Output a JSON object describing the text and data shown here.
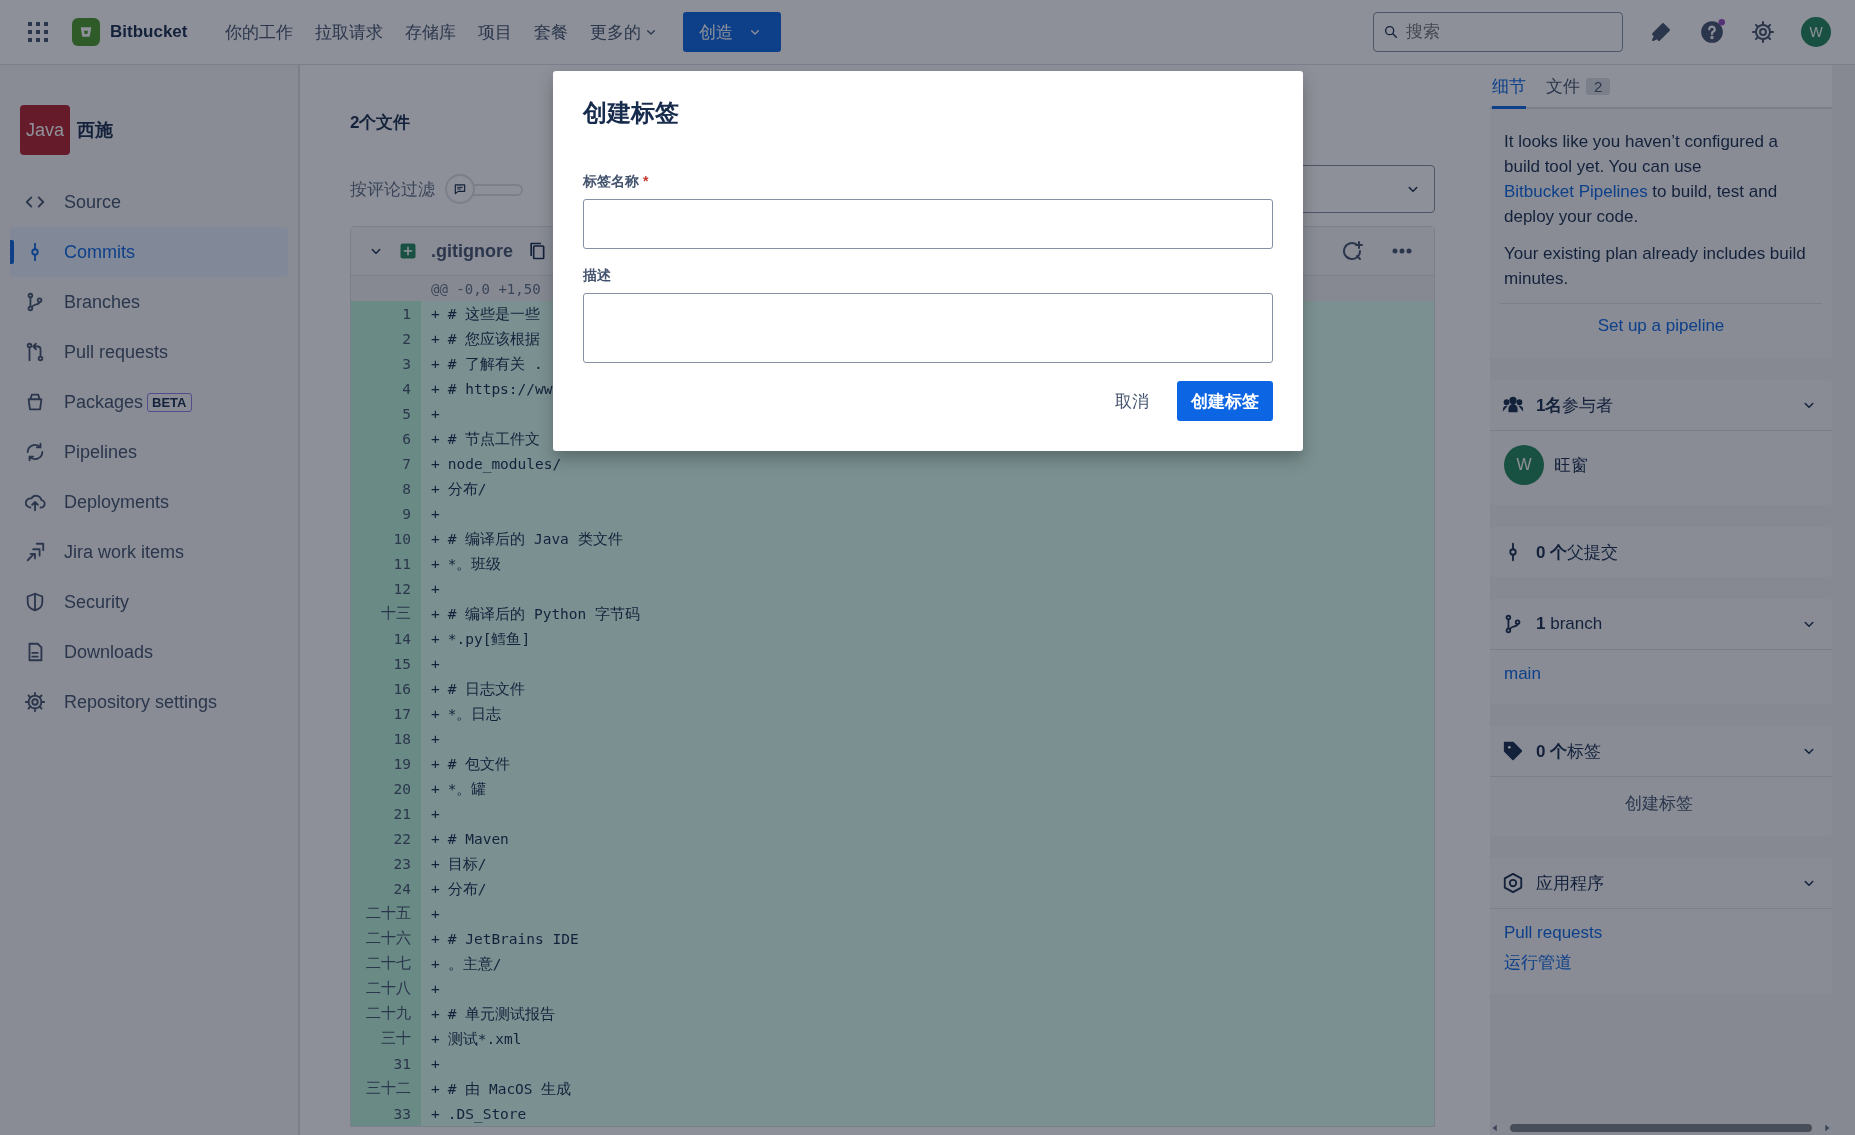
{
  "topbar": {
    "product": "Bitbucket",
    "nav": [
      {
        "label": "你的工作",
        "kind": "link"
      },
      {
        "label": "拉取请求",
        "kind": "link"
      },
      {
        "label": "存储库",
        "kind": "link"
      },
      {
        "label": "项目",
        "kind": "link"
      },
      {
        "label": "套餐",
        "kind": "link"
      },
      {
        "label": "更多的",
        "kind": "menu"
      }
    ],
    "create_button": "创造",
    "search": {
      "placeholder": "搜索"
    },
    "avatar": "W"
  },
  "repo": {
    "badge": "Java",
    "name": "西施"
  },
  "sidebar": {
    "items": [
      {
        "label": "Source",
        "kind": "source",
        "selected": false
      },
      {
        "label": "Commits",
        "kind": "commits",
        "selected": true
      },
      {
        "label": "Branches",
        "kind": "branches",
        "selected": false
      },
      {
        "label": "Pull requests",
        "kind": "pull_requests",
        "selected": false
      },
      {
        "label": "Packages",
        "kind": "packages",
        "selected": false,
        "badge": "BETA"
      },
      {
        "label": "Pipelines",
        "kind": "pipelines",
        "selected": false
      },
      {
        "label": "Deployments",
        "kind": "deployments",
        "selected": false
      },
      {
        "label": "Jira work items",
        "kind": "jira",
        "selected": false
      },
      {
        "label": "Security",
        "kind": "security",
        "selected": false
      },
      {
        "label": "Downloads",
        "kind": "downloads",
        "selected": false
      },
      {
        "label": "Repository settings",
        "kind": "settings",
        "selected": false
      }
    ]
  },
  "diff": {
    "title": "2个文件",
    "filter_label": "按评论过滤",
    "filter_toggle": {
      "on": false
    },
    "file": {
      "name": ".gitignore",
      "expanded": true
    },
    "hunk": "@@ -0,0 +1,50",
    "lines": [
      {
        "number": "1",
        "marker": "+",
        "code": "# 这些是一些"
      },
      {
        "number": "2",
        "marker": "+",
        "code": "# 您应该根据"
      },
      {
        "number": "3",
        "marker": "+",
        "code": "# 了解有关 ."
      },
      {
        "number": "4",
        "marker": "+",
        "code": "# https://ww"
      },
      {
        "number": "5",
        "marker": "+"
      },
      {
        "number": "6",
        "marker": "+",
        "code": "# 节点工件文"
      },
      {
        "number": "7",
        "marker": "+",
        "code": "node_modules/"
      },
      {
        "number": "8",
        "marker": "+",
        "code": "分布/"
      },
      {
        "number": "9",
        "marker": "+"
      },
      {
        "number": "10",
        "marker": "+",
        "code": "# 编译后的 Java 类文件"
      },
      {
        "number": "11",
        "marker": "+",
        "code": "*。班级"
      },
      {
        "number": "12",
        "marker": "+"
      },
      {
        "number": "十三",
        "marker": "+",
        "code": "# 编译后的 Python 字节码"
      },
      {
        "number": "14",
        "marker": "+",
        "code": "*.py[鳕鱼]"
      },
      {
        "number": "15",
        "marker": "+"
      },
      {
        "number": "16",
        "marker": "+",
        "code": "# 日志文件"
      },
      {
        "number": "17",
        "marker": "+",
        "code": "*。日志"
      },
      {
        "number": "18",
        "marker": "+"
      },
      {
        "number": "19",
        "marker": "+",
        "code": "# 包文件"
      },
      {
        "number": "20",
        "marker": "+",
        "code": "*。罐"
      },
      {
        "number": "21",
        "marker": "+"
      },
      {
        "number": "22",
        "marker": "+",
        "code": "# Maven"
      },
      {
        "number": "23",
        "marker": "+",
        "code": "目标/"
      },
      {
        "number": "24",
        "marker": "+",
        "code": "分布/"
      },
      {
        "number": "二十五",
        "marker": "+"
      },
      {
        "number": "二十六",
        "marker": "+",
        "code": "# JetBrains IDE"
      },
      {
        "number": "二十七",
        "marker": "+",
        "code": "。主意/"
      },
      {
        "number": "二十八",
        "marker": "+"
      },
      {
        "number": "二十九",
        "marker": "+",
        "code": "# 单元测试报告"
      },
      {
        "number": "三十",
        "marker": "+",
        "code": "测试*.xml"
      },
      {
        "number": "31",
        "marker": "+"
      },
      {
        "number": "三十二",
        "marker": "+",
        "code": "# 由 MacOS 生成"
      },
      {
        "number": "33",
        "marker": "+",
        "code": ".DS_Store"
      }
    ]
  },
  "modal": {
    "title": "创建标签",
    "fields": [
      {
        "label": "标签名称",
        "required_mark": "*",
        "kind": "input"
      },
      {
        "label": "描述",
        "kind": "textarea"
      }
    ],
    "buttons": [
      {
        "label": "取消",
        "kind": "subtle"
      },
      {
        "label": "创建标签",
        "kind": "primary"
      }
    ]
  },
  "right_panel": {
    "tabs": [
      {
        "label": "细节",
        "selected": true
      },
      {
        "label": "文件",
        "count": "2",
        "selected": false
      }
    ],
    "pipeline_card": {
      "before": "It looks like you haven’t configured a build tool yet. You can use ",
      "link": "Bitbucket Pipelines",
      "after": " to build, test and deploy your code.",
      "plan": "Your existing plan already includes build minutes.",
      "action": "Set up a pipeline"
    },
    "sections": [
      {
        "kind": "participants",
        "title": "**1名**参与者",
        "expandable": true,
        "people": [
          {
            "initial": "W",
            "name": "旺窗"
          }
        ]
      },
      {
        "kind": "parents",
        "title": "**0 个**父提交",
        "expandable": false
      },
      {
        "kind": "branches",
        "title": "**1** branch",
        "expandable": true,
        "links": [
          "main"
        ]
      },
      {
        "kind": "tags",
        "title": "**0 个**标签",
        "expandable": true,
        "action": "创建标签"
      },
      {
        "kind": "apps",
        "title": "应用程序",
        "expandable": true,
        "links": [
          "Pull requests",
          "运行管道"
        ]
      }
    ]
  }
}
